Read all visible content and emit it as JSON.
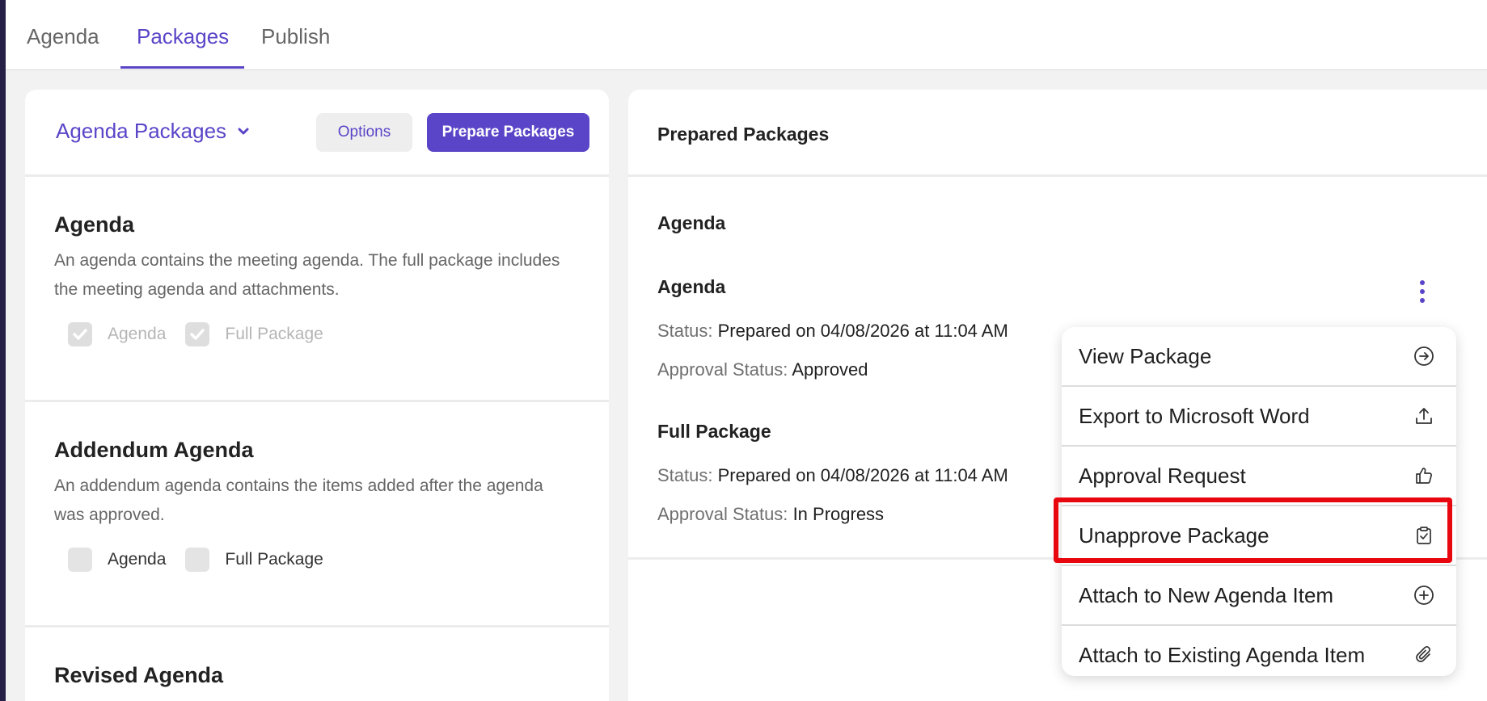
{
  "tabs": [
    {
      "label": "Agenda"
    },
    {
      "label": "Packages"
    },
    {
      "label": "Publish"
    }
  ],
  "left_panel": {
    "dropdown_label": "Agenda Packages",
    "options_label": "Options",
    "prepare_label": "Prepare Packages",
    "sections": [
      {
        "title": "Agenda",
        "description": "An agenda contains the meeting agenda. The full package includes the meeting agenda and attachments.",
        "checkbox_agenda": "Agenda",
        "checkbox_full": "Full Package"
      },
      {
        "title": "Addendum Agenda",
        "description": "An addendum agenda contains the items added after the agenda was approved.",
        "checkbox_agenda": "Agenda",
        "checkbox_full": "Full Package"
      },
      {
        "title": "Revised Agenda"
      }
    ]
  },
  "right_panel": {
    "title": "Prepared Packages",
    "group_title": "Agenda",
    "packages": [
      {
        "name": "Agenda",
        "status_label": "Status:",
        "status_value": "Prepared on 04/08/2026 at 11:04 AM",
        "approval_label": "Approval Status:",
        "approval_value": "Approved"
      },
      {
        "name": "Full Package",
        "status_label": "Status:",
        "status_value": "Prepared on 04/08/2026 at 11:04 AM",
        "approval_label": "Approval Status:",
        "approval_value": "In Progress"
      }
    ]
  },
  "menu": {
    "items": [
      {
        "label": "View Package",
        "icon": "arrow-right-circle-icon"
      },
      {
        "label": "Export to Microsoft Word",
        "icon": "upload-icon"
      },
      {
        "label": "Approval Request",
        "icon": "thumbs-up-icon"
      },
      {
        "label": "Unapprove Package",
        "icon": "clipboard-check-icon"
      },
      {
        "label": "Attach to New Agenda Item",
        "icon": "plus-circle-icon"
      },
      {
        "label": "Attach to Existing Agenda Item",
        "icon": "paperclip-icon"
      }
    ]
  },
  "colors": {
    "accent": "#5a45c8",
    "highlight": "#e8070e",
    "sidebar": "#262046"
  }
}
